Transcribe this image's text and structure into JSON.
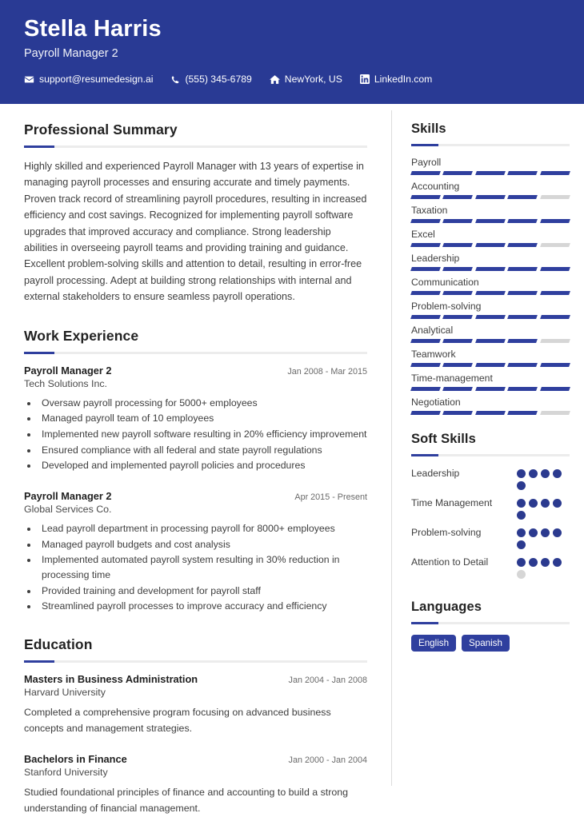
{
  "header": {
    "name": "Stella Harris",
    "job_title": "Payroll Manager 2",
    "accent_color": "#293a94",
    "contacts": [
      {
        "icon": "envelope-icon",
        "text": "support@resumedesign.ai"
      },
      {
        "icon": "phone-icon",
        "text": "(555) 345-6789"
      },
      {
        "icon": "home-icon",
        "text": "NewYork, US"
      },
      {
        "icon": "linkedin-icon",
        "text": "LinkedIn.com"
      }
    ]
  },
  "summary": {
    "heading": "Professional Summary",
    "text": "Highly skilled and experienced Payroll Manager with 13 years of expertise in managing payroll processes and ensuring accurate and timely payments. Proven track record of streamlining payroll procedures, resulting in increased efficiency and cost savings. Recognized for implementing payroll software upgrades that improved accuracy and compliance. Strong leadership abilities in overseeing payroll teams and providing training and guidance. Excellent problem-solving skills and attention to detail, resulting in error-free payroll processing. Adept at building strong relationships with internal and external stakeholders to ensure seamless payroll operations."
  },
  "work_experience": {
    "heading": "Work Experience",
    "entries": [
      {
        "title": "Payroll Manager 2",
        "company": "Tech Solutions Inc.",
        "date": "Jan 2008 - Mar 2015",
        "bullets": [
          "Oversaw payroll processing for 5000+ employees",
          "Managed payroll team of 10 employees",
          "Implemented new payroll software resulting in 20% efficiency improvement",
          "Ensured compliance with all federal and state payroll regulations",
          "Developed and implemented payroll policies and procedures"
        ]
      },
      {
        "title": "Payroll Manager 2",
        "company": "Global Services Co.",
        "date": "Apr 2015 - Present",
        "bullets": [
          "Lead payroll department in processing payroll for 8000+ employees",
          "Managed payroll budgets and cost analysis",
          "Implemented automated payroll system resulting in 30% reduction in processing time",
          "Provided training and development for payroll staff",
          "Streamlined payroll processes to improve accuracy and efficiency"
        ]
      }
    ]
  },
  "education": {
    "heading": "Education",
    "entries": [
      {
        "degree": "Masters in Business Administration",
        "school": "Harvard University",
        "date": "Jan 2004 - Jan 2008",
        "description": "Completed a comprehensive program focusing on advanced business concepts and management strategies."
      },
      {
        "degree": "Bachelors in Finance",
        "school": "Stanford University",
        "date": "Jan 2000 - Jan 2004",
        "description": "Studied foundational principles of finance and accounting to build a strong understanding of financial management."
      }
    ]
  },
  "skills": {
    "heading": "Skills",
    "max_level": 5,
    "items": [
      {
        "label": "Payroll",
        "level": 5
      },
      {
        "label": "Accounting",
        "level": 4
      },
      {
        "label": "Taxation",
        "level": 5
      },
      {
        "label": "Excel",
        "level": 4
      },
      {
        "label": "Leadership",
        "level": 5
      },
      {
        "label": "Communication",
        "level": 5
      },
      {
        "label": "Problem-solving",
        "level": 5
      },
      {
        "label": "Analytical",
        "level": 4
      },
      {
        "label": "Teamwork",
        "level": 5
      },
      {
        "label": "Time-management",
        "level": 5
      },
      {
        "label": "Negotiation",
        "level": 4
      }
    ]
  },
  "soft_skills": {
    "heading": "Soft Skills",
    "max_level": 5,
    "items": [
      {
        "label": "Leadership",
        "level": 5
      },
      {
        "label": "Time Management",
        "level": 5
      },
      {
        "label": "Problem-solving",
        "level": 5
      },
      {
        "label": "Attention to Detail",
        "level": 4
      }
    ]
  },
  "languages": {
    "heading": "Languages",
    "items": [
      "English",
      "Spanish"
    ]
  }
}
